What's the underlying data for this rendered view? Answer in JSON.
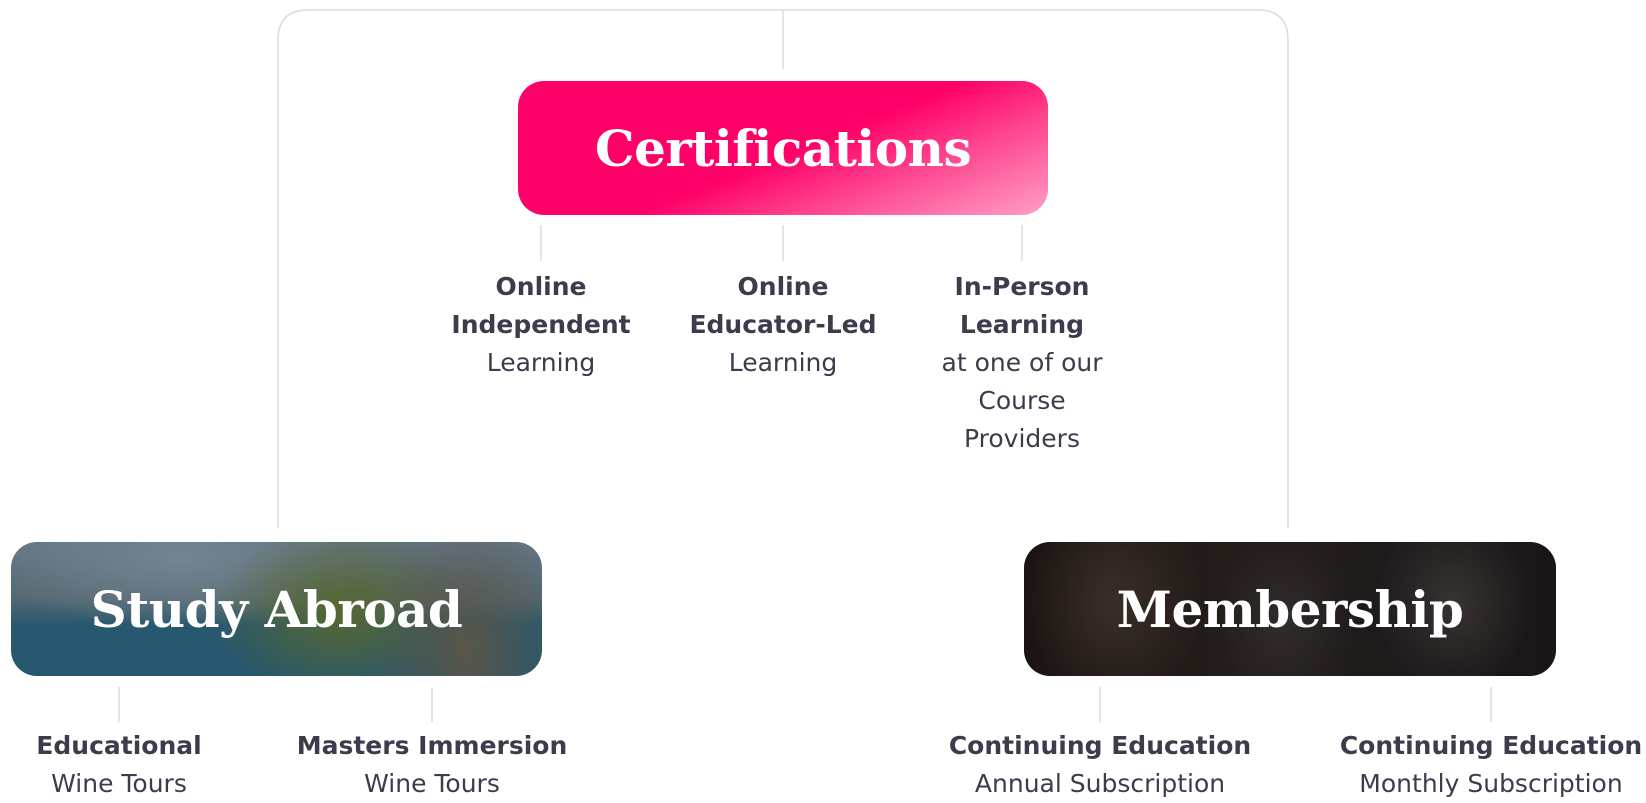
{
  "diagram": {
    "colors": {
      "line": "#dcdcdc",
      "text": "#3d3b4c",
      "accent": "#fe0068",
      "accent_light": "#ff9fc6",
      "title": "#ffffff"
    },
    "certifications": {
      "title": "Certifications",
      "options": [
        {
          "bold": [
            "Online",
            "Independent"
          ],
          "light": [
            "Learning"
          ]
        },
        {
          "bold": [
            "Online",
            "Educator-Led"
          ],
          "light": [
            "Learning"
          ]
        },
        {
          "bold": [
            "In-Person",
            "Learning"
          ],
          "light": [
            "at one of our",
            "Course",
            "Providers"
          ]
        }
      ]
    },
    "study_abroad": {
      "title": "Study Abroad",
      "options": [
        {
          "bold": [
            "Educational"
          ],
          "light": [
            "Wine Tours"
          ]
        },
        {
          "bold": [
            "Masters Immersion"
          ],
          "light": [
            "Wine Tours"
          ]
        }
      ]
    },
    "membership": {
      "title": "Membership",
      "options": [
        {
          "bold": [
            "Continuing Education"
          ],
          "light": [
            "Annual Subscription"
          ]
        },
        {
          "bold": [
            "Continuing Education"
          ],
          "light": [
            "Monthly Subscription"
          ]
        }
      ]
    }
  }
}
